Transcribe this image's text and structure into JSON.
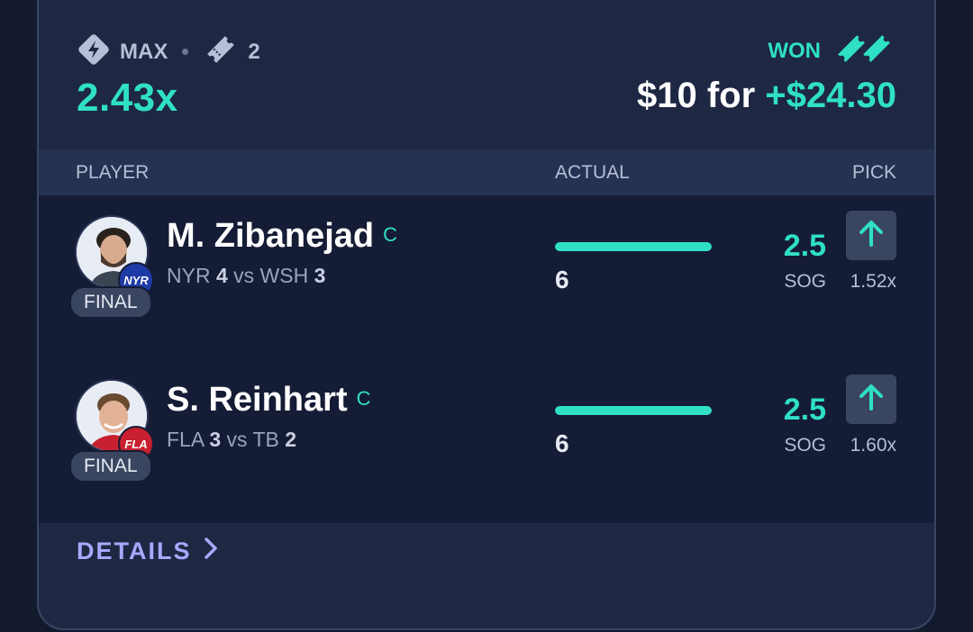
{
  "entry": {
    "mode_label": "MAX",
    "mode_icon": "diamond-bolt-icon",
    "legs_icon": "ticket-icon",
    "legs_count": "2",
    "multiplier": "2.43x",
    "status": "WON",
    "status_icon": "tickets-icon",
    "stake_text": "$10 for",
    "payout_text": "+$24.30"
  },
  "columns": {
    "player": "PLAYER",
    "actual": "ACTUAL",
    "pick": "PICK"
  },
  "picks": [
    {
      "name": "M. Zibanejad",
      "position": "C",
      "team_badge": "NYR",
      "team_color": "#1d3aa6",
      "status": "FINAL",
      "team": "NYR",
      "team_score": "4",
      "vs": "vs",
      "opponent": "WSH",
      "opponent_score": "3",
      "actual": "6",
      "progress": 1.0,
      "line": "2.5",
      "stat": "SOG",
      "direction": "up",
      "direction_icon": "arrow-up-icon",
      "pick_multiplier": "1.52x"
    },
    {
      "name": "S. Reinhart",
      "position": "C",
      "team_badge": "FLA",
      "team_color": "#c8202f",
      "status": "FINAL",
      "team": "FLA",
      "team_score": "3",
      "vs": "vs",
      "opponent": "TB",
      "opponent_score": "2",
      "actual": "6",
      "progress": 1.0,
      "line": "2.5",
      "stat": "SOG",
      "direction": "up",
      "direction_icon": "arrow-up-icon",
      "pick_multiplier": "1.60x"
    }
  ],
  "footer": {
    "details_label": "DETAILS",
    "details_icon": "chevron-right-icon"
  },
  "colors": {
    "accent": "#2fe0c6",
    "link": "#a7a8ff",
    "card": "#1e2843",
    "rows_bg": "#151c35"
  }
}
